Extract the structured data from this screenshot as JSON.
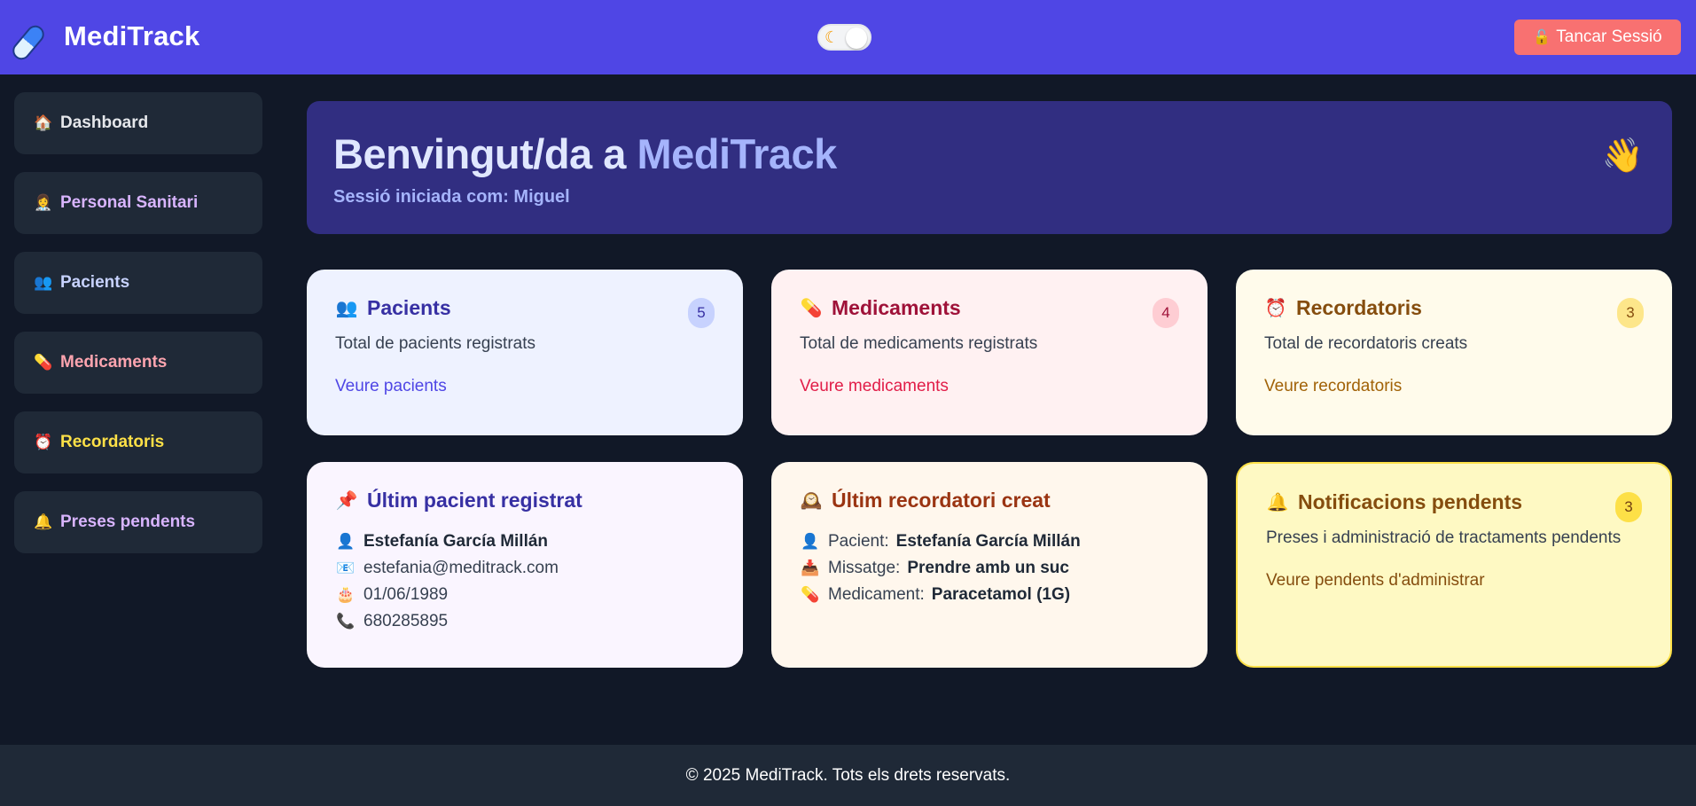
{
  "header": {
    "brand": "MediTrack",
    "brand_icon": "pill-icon",
    "theme_toggle_icon": "moon-icon",
    "logout_icon": "unlock-icon",
    "logout_label": "Tancar Sessió"
  },
  "sidebar": {
    "items": [
      {
        "icon": "🏠",
        "label": "Dashboard",
        "color": "#e5e7eb"
      },
      {
        "icon": "👩‍⚕️",
        "label": "Personal Sanitari",
        "color": "#d8b4fe"
      },
      {
        "icon": "👥",
        "label": "Pacients",
        "color": "#c7d2fe"
      },
      {
        "icon": "💊",
        "label": "Medicaments",
        "color": "#fda4af"
      },
      {
        "icon": "⏰",
        "label": "Recordatoris",
        "color": "#fde047"
      },
      {
        "icon": "🔔",
        "label": "Preses pendents",
        "color": "#d8b4fe"
      }
    ]
  },
  "welcome": {
    "title_prefix": "Benvingut/da a",
    "title_accent": "MediTrack",
    "session_label": "Sessió iniciada com: Miguel",
    "wave_icon": "👋"
  },
  "cards": {
    "patients": {
      "icon": "👥",
      "title": "Pacients",
      "count": "5",
      "desc": "Total de pacients registrats",
      "link": "Veure pacients"
    },
    "medications": {
      "icon": "💊",
      "title": "Medicaments",
      "count": "4",
      "desc": "Total de medicaments registrats",
      "link": "Veure medicaments"
    },
    "reminders": {
      "icon": "⏰",
      "title": "Recordatoris",
      "count": "3",
      "desc": "Total de recordatoris creats",
      "link": "Veure recordatoris"
    },
    "last_patient": {
      "icon": "📌",
      "title": "Últim pacient registrat",
      "name_icon": "👤",
      "name": "Estefanía García Millán",
      "email_icon": "📧",
      "email": "estefania@meditrack.com",
      "birth_icon": "🎂",
      "birth": "01/06/1989",
      "phone_icon": "📞",
      "phone": "680285895"
    },
    "last_reminder": {
      "icon": "🕰️",
      "title": "Últim recordatori creat",
      "patient_icon": "👤",
      "patient_label": "Pacient:",
      "patient": "Estefanía García Millán",
      "message_icon": "📥",
      "message_label": "Missatge:",
      "message": "Prendre amb un suc",
      "med_icon": "💊",
      "med_label": "Medicament:",
      "med": "Paracetamol (1G)"
    },
    "notifications": {
      "icon": "🔔",
      "title": "Notificacions pendents",
      "count": "3",
      "desc": "Preses i administració de tractaments pendents",
      "link": "Veure pendents d'administrar"
    }
  },
  "footer": {
    "text": "© 2025 MediTrack. Tots els drets reservats."
  }
}
